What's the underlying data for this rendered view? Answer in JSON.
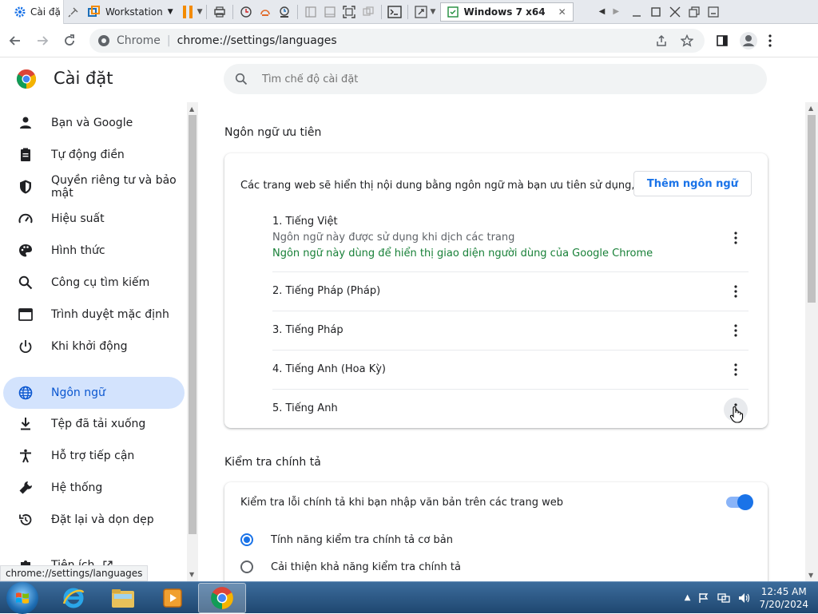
{
  "vmware": {
    "chrome_tab_title": "Cài đặ",
    "workstation_label": "Workstation",
    "vm_tab_label": "Windows 7 x64"
  },
  "browser": {
    "site_label": "Chrome",
    "url": "chrome://settings/languages"
  },
  "settings": {
    "title": "Cài đặt",
    "search_placeholder": "Tìm chế độ cài đặt"
  },
  "sidebar": {
    "items": [
      {
        "label": "Bạn và Google",
        "icon": "person-icon"
      },
      {
        "label": "Tự động điền",
        "icon": "clipboard-icon"
      },
      {
        "label": "Quyền riêng tư và bảo mật",
        "icon": "shield-icon"
      },
      {
        "label": "Hiệu suất",
        "icon": "speedometer-icon"
      },
      {
        "label": "Hình thức",
        "icon": "palette-icon"
      },
      {
        "label": "Công cụ tìm kiếm",
        "icon": "search-icon"
      },
      {
        "label": "Trình duyệt mặc định",
        "icon": "browser-icon"
      },
      {
        "label": "Khi khởi động",
        "icon": "power-icon"
      },
      {
        "label": "Ngôn ngữ",
        "icon": "globe-icon",
        "active": true
      },
      {
        "label": "Tệp đã tải xuống",
        "icon": "download-icon"
      },
      {
        "label": "Hỗ trợ tiếp cận",
        "icon": "accessibility-icon"
      },
      {
        "label": "Hệ thống",
        "icon": "wrench-icon"
      },
      {
        "label": "Đặt lại và dọn dẹp",
        "icon": "restore-icon"
      },
      {
        "label": "Tiện ích",
        "icon": "puzzle-icon"
      }
    ]
  },
  "preferred_languages": {
    "section_title": "Ngôn ngữ ưu tiên",
    "description": "Các trang web sẽ hiển thị nội dung bằng ngôn ngữ mà bạn ưu tiên sử dụng, khi có thể",
    "add_button": "Thêm ngôn ngữ",
    "languages": [
      {
        "name": "1. Tiếng Việt",
        "sub": "Ngôn ngữ này được sử dụng khi dịch các trang",
        "ui_note": "Ngôn ngữ này dùng để hiển thị giao diện người dùng của Google Chrome"
      },
      {
        "name": "2. Tiếng Pháp (Pháp)"
      },
      {
        "name": "3. Tiếng Pháp"
      },
      {
        "name": "4. Tiếng Anh (Hoa Kỳ)"
      },
      {
        "name": "5. Tiếng Anh"
      }
    ]
  },
  "spellcheck": {
    "section_title": "Kiểm tra chính tả",
    "toggle_label": "Kiểm tra lỗi chính tả khi bạn nhập văn bản trên các trang web",
    "toggle_on": true,
    "options": [
      {
        "label": "Tính năng kiểm tra chính tả cơ bản",
        "selected": true
      },
      {
        "label": "Cải thiện khả năng kiểm tra chính tả",
        "selected": false
      }
    ]
  },
  "status_bar_url": "chrome://settings/languages",
  "taskbar": {
    "time": "12:45 AM",
    "date": "7/20/2024"
  },
  "colors": {
    "accent": "#1a73e8",
    "active_nav_bg": "#d3e3fd",
    "ui_language_note": "#188038"
  }
}
